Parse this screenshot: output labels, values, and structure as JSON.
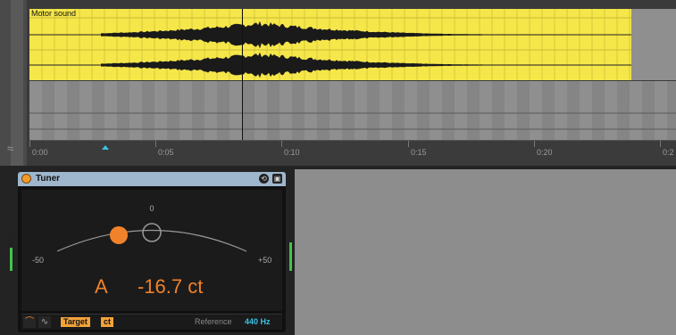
{
  "arrangement": {
    "clip_name": "Motor sound",
    "clip_color": "#f5e64a",
    "ruler_labels": [
      "0:00",
      "0:05",
      "0:10",
      "0:15",
      "0:20",
      "0:2"
    ],
    "loop_icon": "≈"
  },
  "device": {
    "title": "Tuner",
    "power_color": "#f39a2a",
    "header_icons": [
      "hot-swap-icon",
      "save-preset-icon"
    ],
    "zero_label": "0",
    "min_label": "-50",
    "max_label": "+50",
    "note": "A",
    "cents": "-16.7 ct",
    "accent_color": "#f0822a",
    "footer": {
      "curve_icon": "⌒",
      "wave_icon": "∿",
      "target_label": "Target",
      "unit_label": "ct",
      "reference_label": "Reference",
      "reference_value": "440 Hz"
    }
  }
}
